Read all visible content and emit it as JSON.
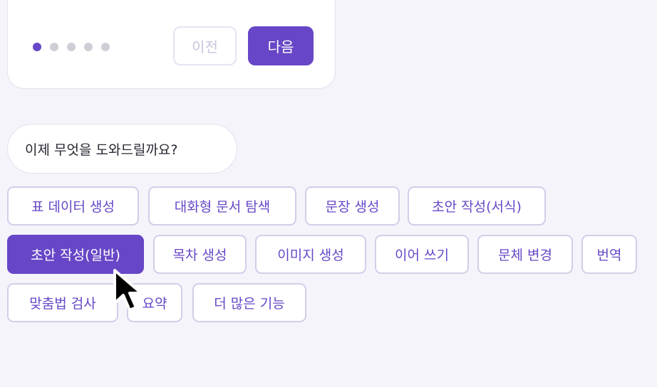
{
  "card": {
    "dots_total": 5,
    "dots_active_index": 0,
    "prev_label": "이전",
    "next_label": "다음"
  },
  "prompt": {
    "question": "이제 무엇을 도와드릴까요?"
  },
  "actions": [
    {
      "label": "표 데이터 생성"
    },
    {
      "label": "대화형 문서 탐색"
    },
    {
      "label": "문장 생성"
    },
    {
      "label": "초안 작성(서식)"
    },
    {
      "label": "초안 작성(일반)",
      "selected": true
    },
    {
      "label": "목차 생성"
    },
    {
      "label": "이미지 생성"
    },
    {
      "label": "이어 쓰기"
    },
    {
      "label": "문체 변경"
    },
    {
      "label": "번역"
    },
    {
      "label": "맞춤법 검사"
    },
    {
      "label": "요약"
    },
    {
      "label": "더 많은 기능"
    }
  ],
  "colors": {
    "accent": "#6747c7",
    "chip_border": "#d3cde9",
    "background": "#f5f4fa"
  },
  "cursor_icon": "mouse-pointer-icon"
}
